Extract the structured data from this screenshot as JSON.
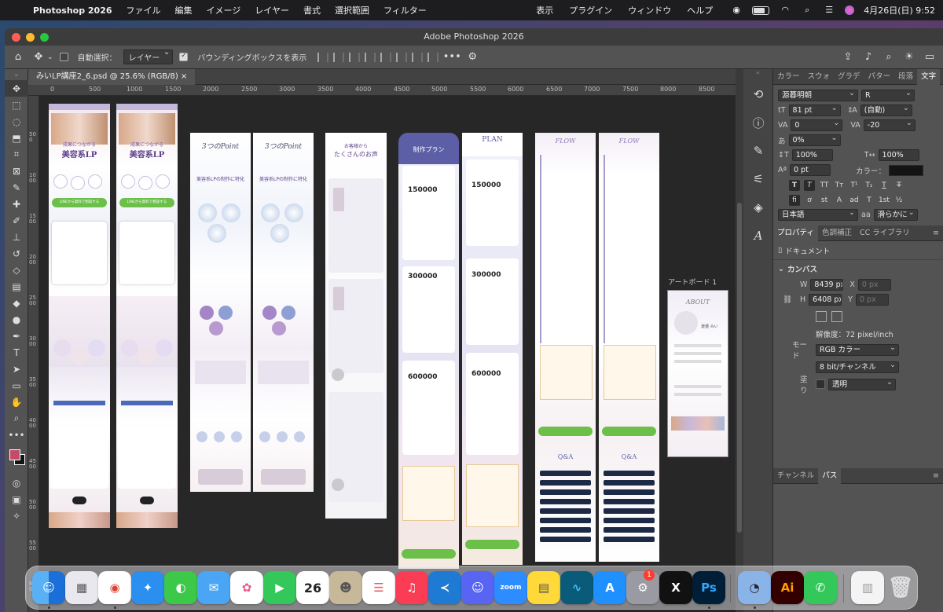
{
  "menubar": {
    "app_name": "Photoshop 2026",
    "menus": [
      "ファイル",
      "編集",
      "イメージ",
      "レイヤー",
      "書式",
      "選択範囲",
      "フィルター"
    ],
    "right_menus": [
      "表示",
      "プラグイン",
      "ウィンドウ",
      "ヘルプ"
    ],
    "datetime": "4月26日(日)  9:52"
  },
  "window": {
    "title": "Adobe Photoshop 2026",
    "document_tab": "みいLP講座2_6.psd @ 25.6% (RGB/8)"
  },
  "options_bar": {
    "auto_select_label": "自動選択：",
    "auto_select_value": "レイヤー",
    "bounding_box_label": "バウンディングボックスを表示",
    "bounding_box_checked": true,
    "auto_select_checked": false
  },
  "ruler": {
    "top_ticks": [
      "0",
      "500",
      "1000",
      "1500",
      "2000",
      "2500",
      "3000",
      "3500",
      "4000",
      "4500",
      "5000",
      "5500",
      "6000",
      "6500",
      "7000",
      "7500",
      "8000",
      "8500"
    ],
    "left_ticks": [
      "500",
      "1000",
      "1500",
      "2000",
      "2500",
      "3000",
      "3500",
      "4000",
      "4500",
      "5000",
      "5500",
      "6000"
    ]
  },
  "canvas": {
    "artboard_label": "アートボード 1",
    "artboards": [
      {
        "heading": "美容系LP",
        "sub": "成果につながる",
        "cta": "LINEから無料で相談する"
      },
      {
        "heading": "美容系LP",
        "sub": "成果につながる",
        "cta": "LINEから無料で相談する"
      },
      {
        "heading": "3つのPoint",
        "sub": "美容系LPの制作に特化"
      },
      {
        "heading": "3つのPoint",
        "sub": "美容系LPの制作に特化"
      },
      {
        "heading": "たくさんのお声",
        "sub": "お客様から"
      },
      {
        "heading": "制作プラン",
        "prices": [
          "150000",
          "300000",
          "600000"
        ]
      },
      {
        "heading": "PLAN",
        "prices": [
          "150000",
          "300000",
          "600000"
        ]
      },
      {
        "heading": "FLOW",
        "sub": "Q&A"
      },
      {
        "heading": "FLOW",
        "sub": "Q&A"
      },
      {
        "heading": "ABOUT",
        "sub": "渡邉 みい"
      }
    ],
    "colors": {
      "background": "#272727",
      "accent_purple": "#5d5fa6",
      "cta_green": "#6cc04a",
      "navy": "#1d2a46"
    }
  },
  "panel_tabs": {
    "top": [
      "カラー",
      "スウォ",
      "グラデ",
      "パター",
      "段落",
      "文字"
    ],
    "active_top": "文字",
    "middle": [
      "プロパティ",
      "色調補正",
      "CC ライブラリ"
    ],
    "bottom": [
      "チャンネル",
      "パス"
    ]
  },
  "character_panel": {
    "font_family": "源暮明朝",
    "font_style": "R",
    "font_size": "81 pt",
    "leading": "(自動)",
    "kerning": "0",
    "tracking": "-20",
    "tsume": "0%",
    "vertical_scale": "100%",
    "horizontal_scale": "100%",
    "baseline_shift": "0 pt",
    "color_label": "カラー：",
    "language": "日本語",
    "antialias_label": "aa",
    "antialias": "滑らかに"
  },
  "properties_panel": {
    "type": "ドキュメント",
    "section": "カンバス",
    "w_label": "W",
    "w_value": "8439 px",
    "h_label": "H",
    "h_value": "6408 px",
    "x_label": "X",
    "x_placeholder": "0 px",
    "y_label": "Y",
    "y_placeholder": "0 px",
    "resolution": "解像度：72 pixel/inch",
    "mode_label": "モード",
    "mode_value": "RGB カラー",
    "depth_value": "8 bit/チャンネル",
    "fill_label": "塗り",
    "fill_value": "透明"
  },
  "dock": {
    "calendar_day": "26",
    "settings_badge": "1",
    "ps_label": "Ps",
    "ai_label": "Ai",
    "zoom_label": "zoom",
    "x_label": "X"
  }
}
